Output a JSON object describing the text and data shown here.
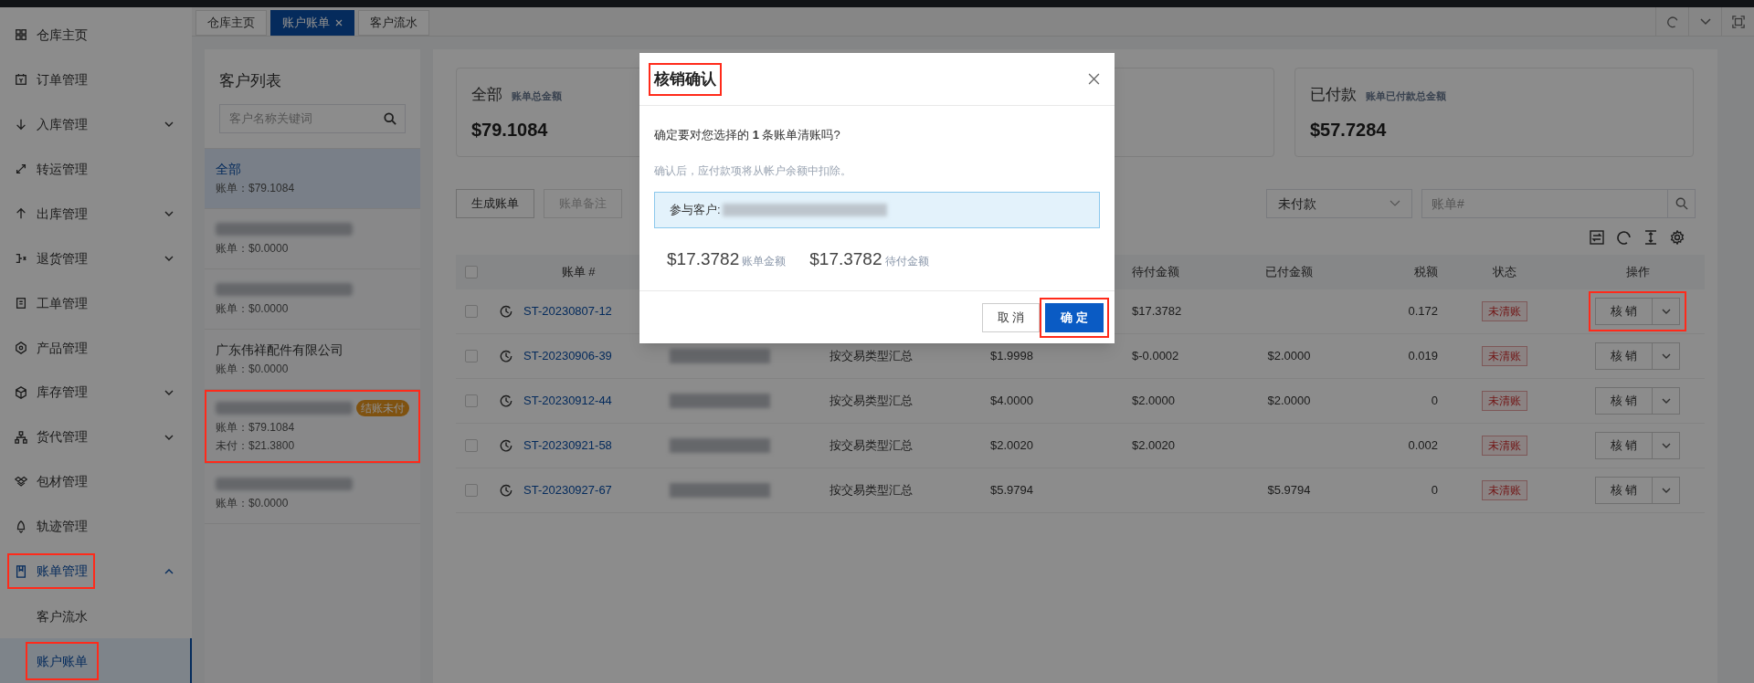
{
  "sidebar": {
    "items": [
      {
        "label": "仓库主页",
        "selected": false
      },
      {
        "label": "订单管理",
        "selected": false
      },
      {
        "label": "入库管理",
        "selected": false,
        "expanded": false
      },
      {
        "label": "转运管理",
        "selected": false
      },
      {
        "label": "出库管理",
        "selected": false,
        "expanded": false
      },
      {
        "label": "退货管理",
        "selected": false,
        "expanded": false
      },
      {
        "label": "工单管理",
        "selected": false
      },
      {
        "label": "产品管理",
        "selected": false
      },
      {
        "label": "库存管理",
        "selected": false,
        "expanded": false
      },
      {
        "label": "货代管理",
        "selected": false,
        "expanded": false
      },
      {
        "label": "包材管理",
        "selected": false
      },
      {
        "label": "轨迹管理",
        "selected": false
      },
      {
        "label": "账单管理",
        "selected": false,
        "expanded": true,
        "highlighted": true,
        "children": [
          {
            "label": "客户流水",
            "selected": false
          },
          {
            "label": "账户账单",
            "selected": true,
            "highlighted": true
          }
        ]
      }
    ]
  },
  "tabs": [
    {
      "label": "仓库主页",
      "selected": false
    },
    {
      "label": "账户账单",
      "selected": true,
      "closable": true
    },
    {
      "label": "客户流水",
      "selected": false
    }
  ],
  "customer_list": {
    "title": "客户列表",
    "search": {
      "placeholder": "客户名称关键词"
    },
    "items": [
      {
        "kind": "named",
        "name": "全部",
        "selected": true,
        "lines": [
          "账单：$79.1084"
        ]
      },
      {
        "kind": "redacted",
        "selected": false,
        "lines": [
          "账单：$0.0000"
        ]
      },
      {
        "kind": "redacted",
        "selected": false,
        "lines": [
          "账单：$0.0000"
        ]
      },
      {
        "kind": "named",
        "name": "广东伟祥配件有限公司",
        "selected": false,
        "lines": [
          "账单：$0.0000"
        ]
      },
      {
        "kind": "redacted",
        "selected": false,
        "badge": "结账未付",
        "highlighted": true,
        "lines": [
          "账单：$79.1084",
          "未付：$21.3800"
        ]
      },
      {
        "kind": "redacted",
        "selected": false,
        "lines": [
          "账单：$0.0000"
        ]
      }
    ]
  },
  "summary_cards": [
    {
      "title": "全部",
      "subtitle": "账单总金额",
      "amount": "$79.1084"
    },
    {
      "title": "已付款",
      "subtitle": "账单已付款总金额",
      "amount": "$57.7284"
    }
  ],
  "toolbar": {
    "buttons": [
      {
        "label": "生成账单",
        "disabled": false
      },
      {
        "label": "账单备注",
        "disabled": true
      }
    ],
    "filter": {
      "value": "未付款"
    },
    "search": {
      "placeholder": "账单#"
    }
  },
  "table": {
    "select_all": {
      "checked": false
    },
    "header": {
      "bill_no": "账单 #",
      "pending": "待付金额",
      "paid": "已付金额",
      "tax": "税额",
      "status": "状态",
      "actions": "操作"
    },
    "rows": [
      {
        "checked": false,
        "bill_no": "ST-20230807-12",
        "pending": "$17.3782",
        "tax": "0.172",
        "status": "未清账",
        "action": "核 销",
        "highlighted": true
      },
      {
        "checked": false,
        "bill_no": "ST-20230906-39",
        "type": "按交易类型汇总",
        "amount": "$1.9998",
        "pending": "$-0.0002",
        "paid": "$2.0000",
        "tax": "0.019",
        "status": "未清账",
        "action": "核 销"
      },
      {
        "checked": false,
        "bill_no": "ST-20230912-44",
        "type": "按交易类型汇总",
        "amount": "$4.0000",
        "pending": "$2.0000",
        "paid": "$2.0000",
        "tax": "0",
        "status": "未清账",
        "action": "核 销"
      },
      {
        "checked": false,
        "bill_no": "ST-20230921-58",
        "type": "按交易类型汇总",
        "amount": "$2.0020",
        "pending": "$2.0020",
        "tax": "0.002",
        "status": "未清账",
        "action": "核 销"
      },
      {
        "checked": false,
        "bill_no": "ST-20230927-67",
        "type": "按交易类型汇总",
        "amount": "$5.9794",
        "paid": "$5.9794",
        "tax": "0",
        "status": "未清账",
        "action": "核 销"
      }
    ]
  },
  "dialog": {
    "title": "核销确认",
    "title_highlighted": true,
    "question": "确定要对您选择的 **1** 条账单清账吗?",
    "hint": "确认后，应付款项将从帐户余额中扣除。",
    "customer_label": "参与客户:",
    "amounts": [
      {
        "value": "$17.3782",
        "label": "账单金额"
      },
      {
        "value": "$17.3782",
        "label": "待付金额"
      }
    ],
    "buttons": [
      {
        "label": "取 消",
        "kind": "secondary"
      },
      {
        "label": "确 定",
        "kind": "primary",
        "highlighted": true
      }
    ]
  }
}
